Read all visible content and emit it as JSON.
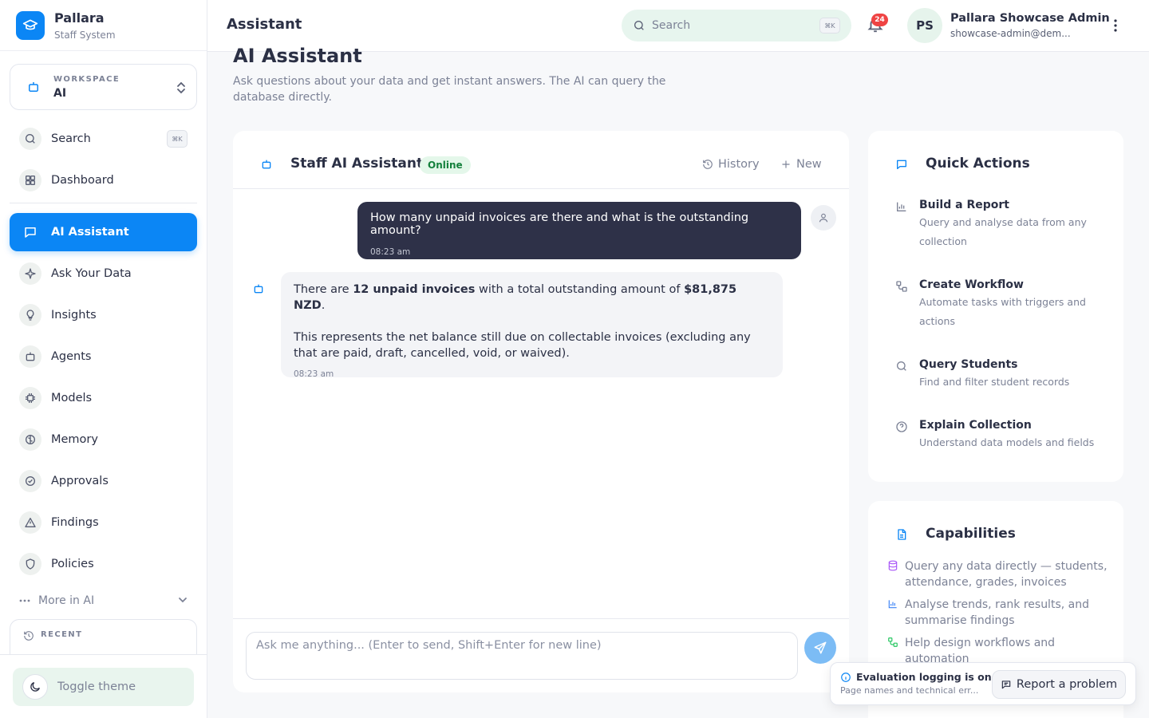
{
  "brand": {
    "name": "Pallara",
    "subtitle": "Staff System"
  },
  "workspace": {
    "label": "WORKSPACE",
    "value": "AI"
  },
  "sidebar": {
    "search": {
      "label": "Search",
      "shortcut": "⌘K"
    },
    "items": [
      {
        "label": "Dashboard",
        "icon": "grid-icon"
      },
      {
        "label": "AI Assistant",
        "icon": "chat-icon",
        "active": true
      },
      {
        "label": "Ask Your Data",
        "icon": "sparkle-icon"
      },
      {
        "label": "Insights",
        "icon": "lightbulb-icon"
      },
      {
        "label": "Agents",
        "icon": "bot-icon"
      },
      {
        "label": "Models",
        "icon": "chip-icon"
      },
      {
        "label": "Memory",
        "icon": "brain-icon"
      },
      {
        "label": "Approvals",
        "icon": "check-circle-icon"
      },
      {
        "label": "Findings",
        "icon": "warning-icon"
      },
      {
        "label": "Policies",
        "icon": "shield-icon"
      }
    ],
    "more_label": "More in AI",
    "recent_label": "RECENT",
    "toggle_theme": "Toggle theme"
  },
  "header": {
    "title": "Assistant",
    "search_placeholder": "Search",
    "search_shortcut": "⌘K",
    "notification_count": "24",
    "user_initials": "PS",
    "user_name": "Pallara Showcase Admin",
    "user_email": "showcase-admin@dem..."
  },
  "page": {
    "title": "AI Assistant",
    "subtitle": "Ask questions about your data and get instant answers. The AI can query the database directly."
  },
  "chat": {
    "title": "Staff AI Assistant",
    "status": "Online",
    "history_label": "History",
    "new_label": "New",
    "user_message": {
      "text": "How many unpaid invoices are there and what is the outstanding amount?",
      "time": "08:23 am"
    },
    "bot_message": {
      "p1_prefix": "There are ",
      "p1_bold1": "12 unpaid invoices",
      "p1_middle": " with a total outstanding amount of ",
      "p1_bold2": "$81,875 NZD",
      "p1_suffix": ".",
      "p2": "This represents the net balance still due on collectable invoices (excluding any that are paid, draft, cancelled, void, or waived).",
      "time": "08:23 am"
    },
    "composer_placeholder": "Ask me anything... (Enter to send, Shift+Enter for new line)"
  },
  "quick_actions": {
    "title": "Quick Actions",
    "items": [
      {
        "title": "Build a Report",
        "desc": "Query and analyse data from any collection",
        "icon": "bar-chart-icon"
      },
      {
        "title": "Create Workflow",
        "desc": "Automate tasks with triggers and actions",
        "icon": "workflow-icon"
      },
      {
        "title": "Query Students",
        "desc": "Find and filter student records",
        "icon": "search-icon"
      },
      {
        "title": "Explain Collection",
        "desc": "Understand data models and fields",
        "icon": "help-circle-icon"
      }
    ]
  },
  "capabilities": {
    "title": "Capabilities",
    "items": [
      {
        "text": "Query any data directly — students, attendance, grades, invoices",
        "icon": "database-icon",
        "color": "#a855f7"
      },
      {
        "text": "Analyse trends, rank results, and summarise findings",
        "icon": "bar-chart-icon",
        "color": "#3b82f6"
      },
      {
        "text": "Help design workflows and automation",
        "icon": "workflow-icon",
        "color": "#22c55e"
      }
    ]
  },
  "toast": {
    "title": "Evaluation logging is on",
    "desc": "Page names and technical err...",
    "button": "Report a problem"
  },
  "colors": {
    "accent": "#0b86f5",
    "user_bubble": "#2e3148",
    "online": "#14803c",
    "badge": "#ef4444"
  }
}
